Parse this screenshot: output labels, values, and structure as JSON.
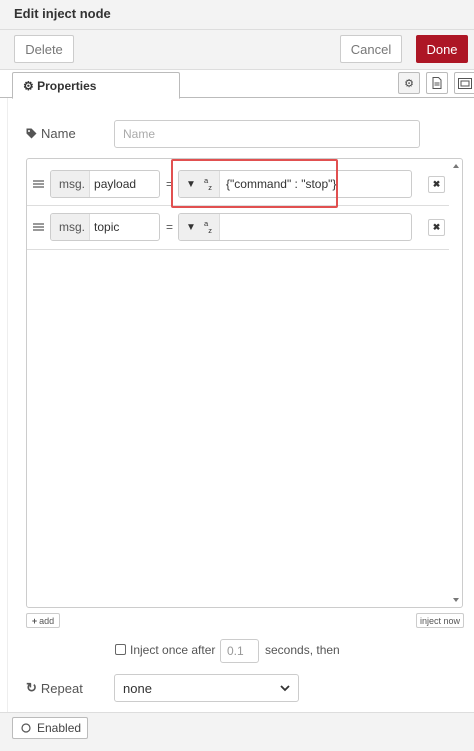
{
  "dialog": {
    "title": "Edit inject node"
  },
  "toolbar": {
    "delete_label": "Delete",
    "cancel_label": "Cancel",
    "done_label": "Done"
  },
  "tabs": {
    "properties_label": "Properties"
  },
  "form": {
    "name_label": "Name",
    "name_placeholder": "Name",
    "properties": [
      {
        "prefix": "msg.",
        "key": "payload",
        "equals": "=",
        "type_icon": "az",
        "value": "{\"command\" : \"stop\"}"
      },
      {
        "prefix": "msg.",
        "key": "topic",
        "equals": "=",
        "type_icon": "az",
        "value": ""
      }
    ],
    "add_label": "add",
    "inject_now_label": "inject now",
    "inject_once_label": "Inject once after",
    "inject_delay": "0.1",
    "seconds_label": "seconds, then",
    "repeat_label": "Repeat",
    "repeat_value": "none"
  },
  "footer": {
    "enabled_label": "Enabled"
  },
  "colors": {
    "done_bg": "#ad1625",
    "highlight": "#e15050"
  },
  "icons": [
    "gear-icon",
    "document-icon",
    "frame-icon",
    "tag-icon",
    "drag-handle-icon",
    "caret-down-icon",
    "close-icon",
    "plus-icon",
    "repeat-icon",
    "circle-icon"
  ]
}
